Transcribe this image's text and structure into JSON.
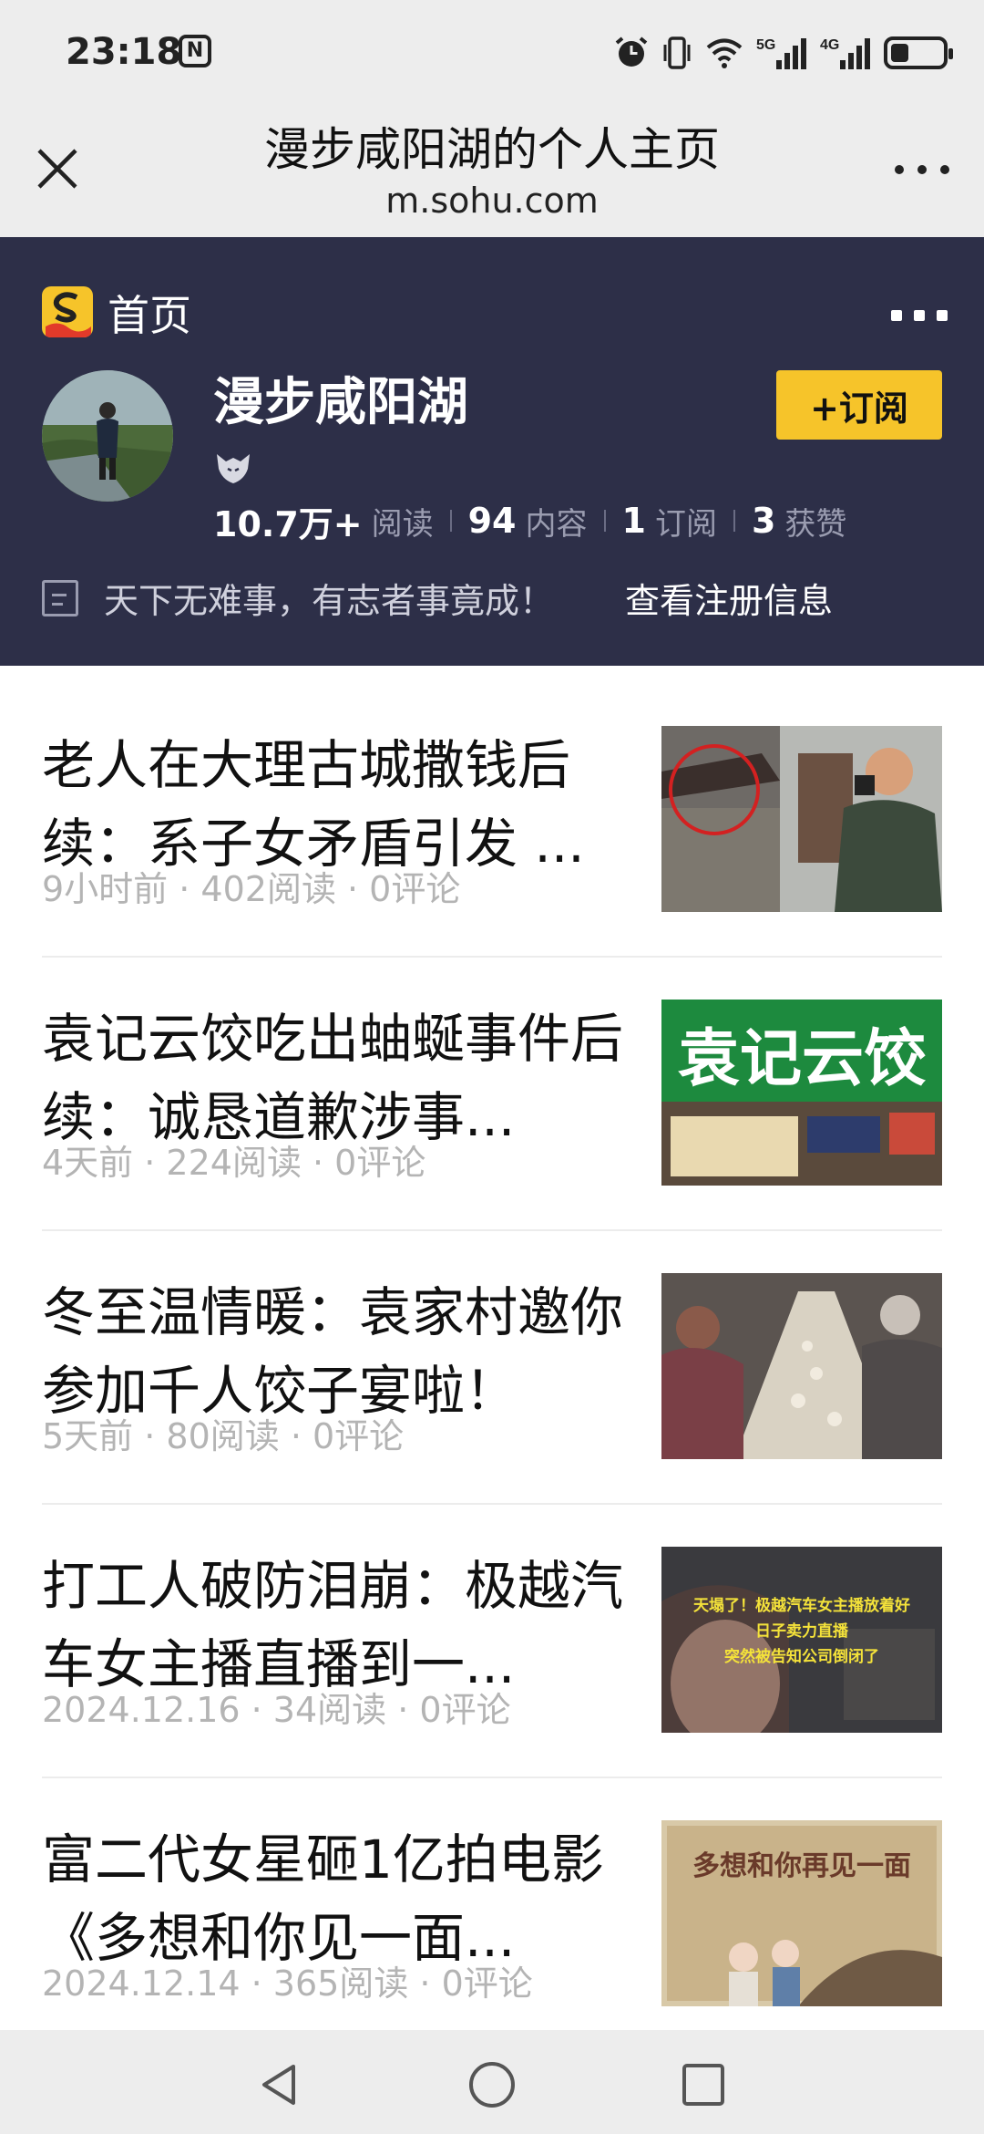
{
  "status_bar": {
    "time": "23:18",
    "nfc_label": "N",
    "icons": [
      "alarm-icon",
      "vibrate-icon",
      "wifi-icon",
      "signal-5g-icon",
      "signal-4g-icon"
    ],
    "net1": "5G",
    "net2": "4G",
    "battery_level": 0.35
  },
  "title_bar": {
    "title": "漫步咸阳湖的个人主页",
    "url": "m.sohu.com"
  },
  "profile": {
    "home_label": "首页",
    "name": "漫步咸阳湖",
    "subscribe_label": "+订阅",
    "stats": [
      {
        "value": "10.7万+",
        "label": "阅读"
      },
      {
        "value": "94",
        "label": "内容"
      },
      {
        "value": "1",
        "label": "订阅"
      },
      {
        "value": "3",
        "label": "获赞"
      }
    ],
    "bio": "天下无难事，有志者事竟成！",
    "register_info_link": "查看注册信息",
    "colors": {
      "header_bg": "#2d2f48",
      "accent": "#f6c42a"
    }
  },
  "articles": [
    {
      "title": "老人在大理古城撒钱后续：系子女矛盾引发 ...",
      "meta": "9小时前 · 402阅读 · 0评论",
      "thumb_icon": "ancient-city-photo"
    },
    {
      "title": "袁记云饺吃出蚰蜒事件后续：诚恳道歉涉事...",
      "meta": "4天前 · 224阅读 · 0评论",
      "thumb_icon": "storefront-photo",
      "thumb_text": "袁记云饺"
    },
    {
      "title": "冬至温情暖：袁家村邀你参加千人饺子宴啦！",
      "meta": "5天前 · 80阅读 · 0评论",
      "thumb_icon": "dumpling-banquet-photo"
    },
    {
      "title": "打工人破防泪崩：极越汽车女主播直播到一...",
      "meta": "2024.12.16 · 34阅读 · 0评论",
      "thumb_icon": "livestream-photo",
      "thumb_text": [
        "天塌了！极越汽车女主播放着好",
        "日子卖力直播",
        "突然被告知公司倒闭了"
      ]
    },
    {
      "title": "富二代女星砸1亿拍电影《多想和你见一面...",
      "meta": "2024.12.14 · 365阅读 · 0评论",
      "thumb_icon": "movie-poster-photo",
      "thumb_text": "多想和你再见一面"
    }
  ]
}
